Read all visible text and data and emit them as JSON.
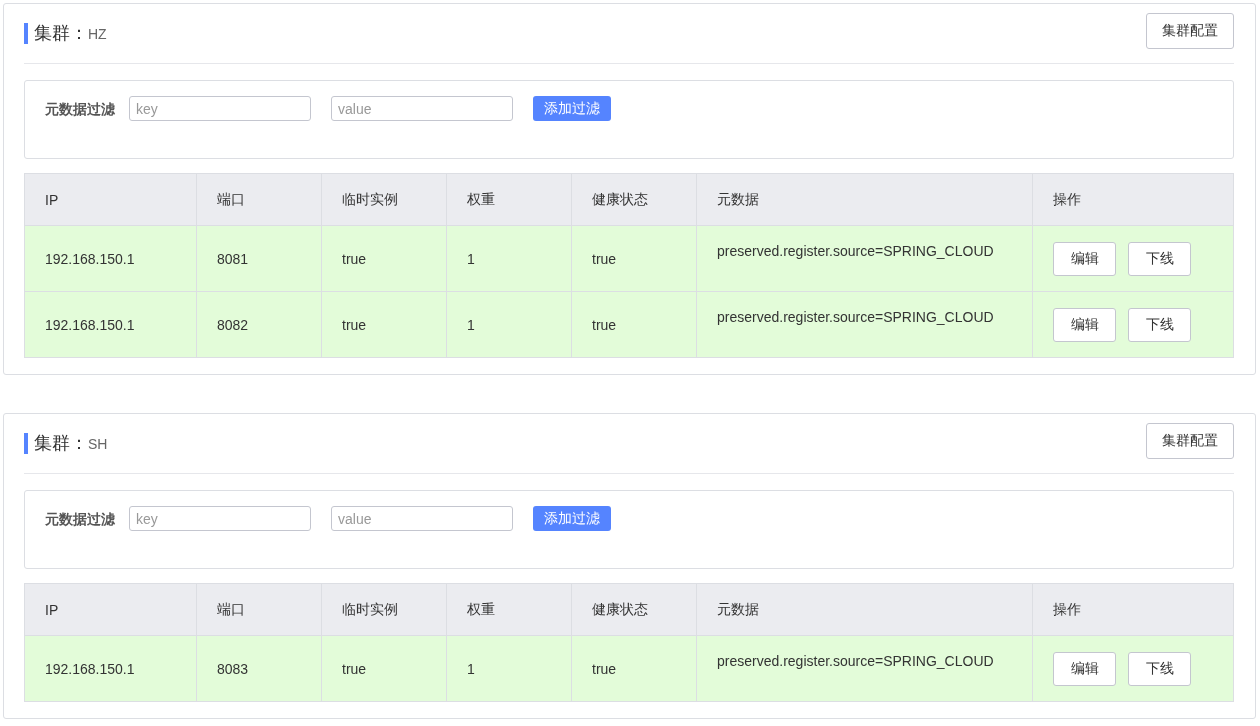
{
  "clusters": [
    {
      "title": "集群：",
      "name": "HZ",
      "config_button": "集群配置",
      "filter": {
        "label": "元数据过滤",
        "key_placeholder": "key",
        "value_placeholder": "value",
        "button": "添加过滤"
      },
      "table": {
        "columns": [
          "IP",
          "端口",
          "临时实例",
          "权重",
          "健康状态",
          "元数据",
          "操作"
        ],
        "rows": [
          {
            "cells": [
              "192.168.150.1",
              "8081",
              "true",
              "1",
              "true",
              "preserved.register.source=SPRING_CLOUD"
            ],
            "actions": [
              "编辑",
              "下线"
            ]
          },
          {
            "cells": [
              "192.168.150.1",
              "8082",
              "true",
              "1",
              "true",
              "preserved.register.source=SPRING_CLOUD"
            ],
            "actions": [
              "编辑",
              "下线"
            ]
          }
        ]
      }
    },
    {
      "title": "集群：",
      "name": "SH",
      "config_button": "集群配置",
      "filter": {
        "label": "元数据过滤",
        "key_placeholder": "key",
        "value_placeholder": "value",
        "button": "添加过滤"
      },
      "table": {
        "columns": [
          "IP",
          "端口",
          "临时实例",
          "权重",
          "健康状态",
          "元数据",
          "操作"
        ],
        "rows": [
          {
            "cells": [
              "192.168.150.1",
              "8083",
              "true",
              "1",
              "true",
              "preserved.register.source=SPRING_CLOUD"
            ],
            "actions": [
              "编辑",
              "下线"
            ]
          }
        ]
      }
    }
  ]
}
